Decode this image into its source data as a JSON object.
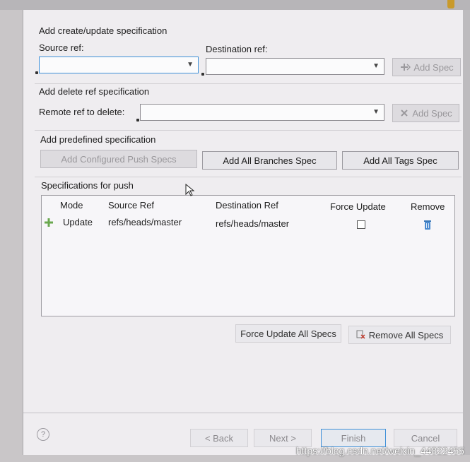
{
  "sections": {
    "add_update": "Add create/update specification",
    "delete": "Add delete ref specification",
    "predefined": "Add predefined specification",
    "push_specs": "Specifications for push"
  },
  "labels": {
    "source_ref": "Source ref:",
    "destination_ref": "Destination ref:",
    "remote_ref_to_delete": "Remote ref to delete:"
  },
  "inputs": {
    "source_ref_value": "",
    "destination_ref_value": "",
    "remote_ref_to_delete_value": ""
  },
  "buttons": {
    "add_spec": "Add Spec",
    "add_spec_delete": "Add Spec",
    "add_configured_push_specs": "Add Configured Push Specs",
    "add_all_branches_spec": "Add All Branches Spec",
    "add_all_tags_spec": "Add All Tags Spec",
    "force_update_all_specs": "Force Update All Specs",
    "remove_all_specs": "Remove All Specs",
    "back": "< Back",
    "next": "Next >",
    "finish": "Finish",
    "cancel": "Cancel"
  },
  "table": {
    "columns": [
      "Mode",
      "Source Ref",
      "Destination Ref",
      "Force Update",
      "Remove"
    ],
    "rows": [
      {
        "mode": "Update",
        "source_ref": "refs/heads/master",
        "destination_ref": "refs/heads/master",
        "force_update": false
      }
    ]
  },
  "watermark": "https://blog.csdn.net/weixin_44822455",
  "help_glyph": "?",
  "icons": {
    "add_row": "plus-icon",
    "remove_row": "trash-icon",
    "add_spec": "add-spec-icon",
    "delete_spec": "delete-spec-icon"
  }
}
